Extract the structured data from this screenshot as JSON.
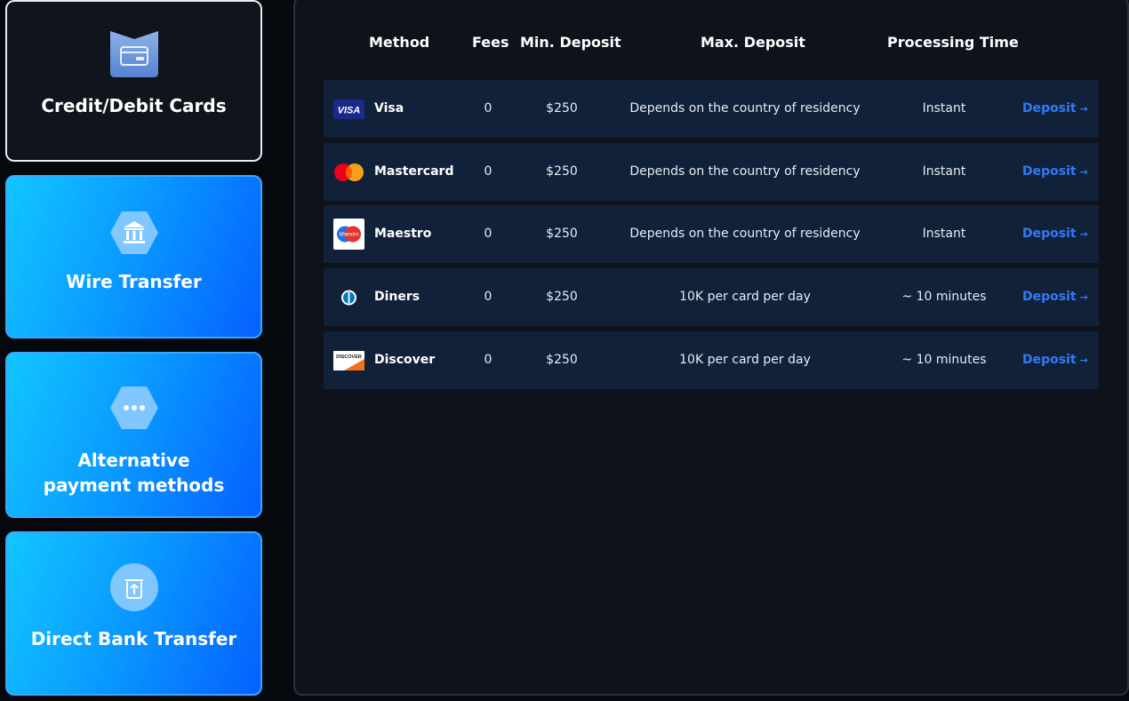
{
  "sidebar": {
    "categories": [
      {
        "label": "Credit/Debit Cards",
        "icon": "card-icon",
        "active": true
      },
      {
        "label": "Wire Transfer",
        "icon": "bank-icon",
        "active": false
      },
      {
        "label": "Alternative payment methods",
        "icon": "more-dots-icon",
        "active": false
      },
      {
        "label": "Direct Bank Transfer",
        "icon": "bank-upload-icon",
        "active": false
      }
    ]
  },
  "table": {
    "headers": {
      "method": "Method",
      "fees": "Fees",
      "min_deposit": "Min. Deposit",
      "max_deposit": "Max. Deposit",
      "processing_time": "Processing Time"
    },
    "rows": [
      {
        "name": "Visa",
        "logo": "visa-logo-icon",
        "fees": "0",
        "min": "$250",
        "max": "Depends on the country of residency",
        "time": "Instant",
        "action": "Deposit"
      },
      {
        "name": "Mastercard",
        "logo": "mastercard-logo-icon",
        "fees": "0",
        "min": "$250",
        "max": "Depends on the country of residency",
        "time": "Instant",
        "action": "Deposit"
      },
      {
        "name": "Maestro",
        "logo": "maestro-logo-icon",
        "fees": "0",
        "min": "$250",
        "max": "Depends on the country of residency",
        "time": "Instant",
        "action": "Deposit"
      },
      {
        "name": "Diners",
        "logo": "diners-logo-icon",
        "fees": "0",
        "min": "$250",
        "max": "10K per card per day",
        "time": "~ 10 minutes",
        "action": "Deposit"
      },
      {
        "name": "Discover",
        "logo": "discover-logo-icon",
        "fees": "0",
        "min": "$250",
        "max": "10K per card per day",
        "time": "~ 10 minutes",
        "action": "Deposit"
      }
    ]
  },
  "logo_text": {
    "visa": "VISA",
    "maestro": "Maestro",
    "discover": "DISCOVER"
  },
  "colors": {
    "accent_link": "#2f7cf6",
    "row_bg": "#12213a",
    "card_gradient_start": "#12c6ff",
    "card_gradient_end": "#0560ff"
  }
}
